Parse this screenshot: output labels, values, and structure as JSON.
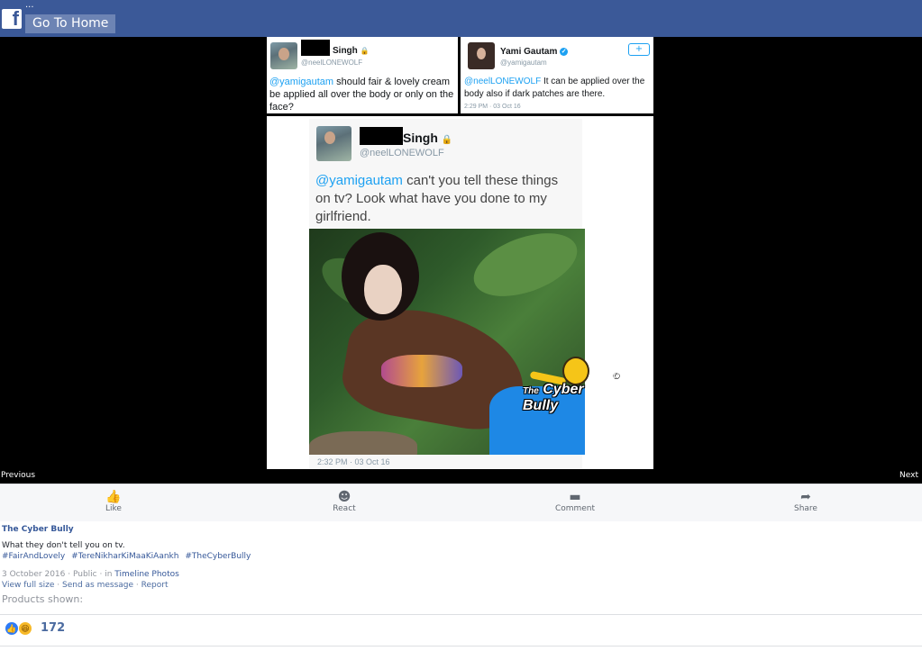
{
  "header": {
    "logo_letter": "f",
    "dots": "...",
    "home_button": "Go To Home"
  },
  "photo": {
    "nav_previous": "Previous",
    "nav_next": "Next",
    "tweet1": {
      "name": "Singh",
      "handle": "@neelLONEWOLF",
      "mention": "@yamigautam",
      "text": " should fair & lovely cream be applied all over the body or only on the face?"
    },
    "tweet2": {
      "name": "Yami Gautam",
      "handle": "@yamigautam",
      "mention": "@neelLONEWOLF",
      "text": " It can be applied over the body also if dark patches are there.",
      "time": "2:29 PM · 03 Oct 16"
    },
    "tweet3": {
      "name": "Singh",
      "handle": "@neelLONEWOLF",
      "mention": "@yamigautam",
      "text": " can't you tell these things on tv? Look what have you done to my girlfriend.",
      "time": "2:32 PM · 03 Oct 16"
    },
    "watermark": {
      "line1": "The",
      "line2": "Cyber Bully",
      "copyright": "©"
    }
  },
  "actions": [
    {
      "label": "Like",
      "icon": "thumbs-up-icon",
      "glyph": "👍"
    },
    {
      "label": "React",
      "icon": "smiley-icon",
      "glyph": "☻"
    },
    {
      "label": "Comment",
      "icon": "comment-icon",
      "glyph": "▬"
    },
    {
      "label": "Share",
      "icon": "share-icon",
      "glyph": "➦"
    }
  ],
  "post": {
    "author": "The Cyber Bully",
    "caption": "What they don't tell you on tv.",
    "hashtags": [
      "#FairAndLovely",
      "#TereNikharKiMaaKiAankh",
      "#TheCyberBully"
    ],
    "date": "3 October 2016",
    "privacy": "Public",
    "in_text": "in",
    "album": "Timeline Photos",
    "view_full": "View full size",
    "send_message": "Send as message",
    "report": "Report",
    "products_label": "Products shown:",
    "reaction_count": "172"
  },
  "colors": {
    "brand": "#3b5998",
    "link": "#365899",
    "twitter_blue": "#1da1f2"
  }
}
